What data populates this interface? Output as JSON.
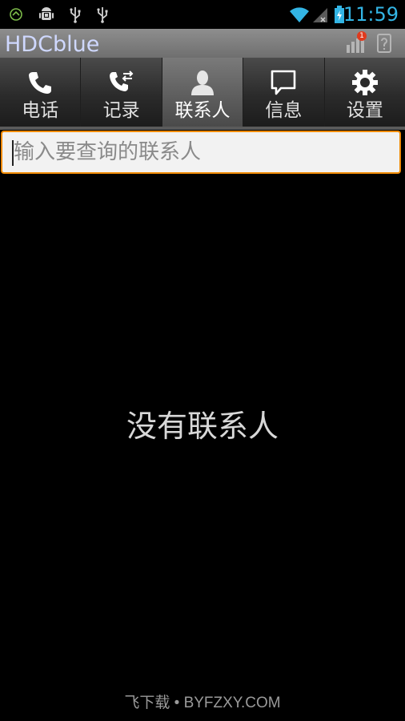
{
  "status_bar": {
    "time": "11:59",
    "left_icons": [
      "android-circle-icon",
      "android-robot-icon",
      "usb-icon",
      "usb-icon"
    ],
    "right_icons": [
      "wifi-icon",
      "signal-icon",
      "battery-charging-icon"
    ],
    "time_color": "#33b5e5"
  },
  "app": {
    "title": "HDCblue",
    "notification_count": "1",
    "actions": [
      "signal-bars-icon",
      "help-icon"
    ]
  },
  "tabs": [
    {
      "label": "电话",
      "icon": "phone-icon",
      "active": false
    },
    {
      "label": "记录",
      "icon": "call-log-icon",
      "active": false
    },
    {
      "label": "联系人",
      "icon": "contact-icon",
      "active": true
    },
    {
      "label": "信息",
      "icon": "message-icon",
      "active": false
    },
    {
      "label": "设置",
      "icon": "gear-icon",
      "active": false
    }
  ],
  "search": {
    "placeholder": "输入要查询的联系人",
    "value": "",
    "accent_color": "#f08a00"
  },
  "empty_state": {
    "message": "没有联系人"
  },
  "watermark": {
    "text": "飞下载 • BYFZXY.COM"
  }
}
